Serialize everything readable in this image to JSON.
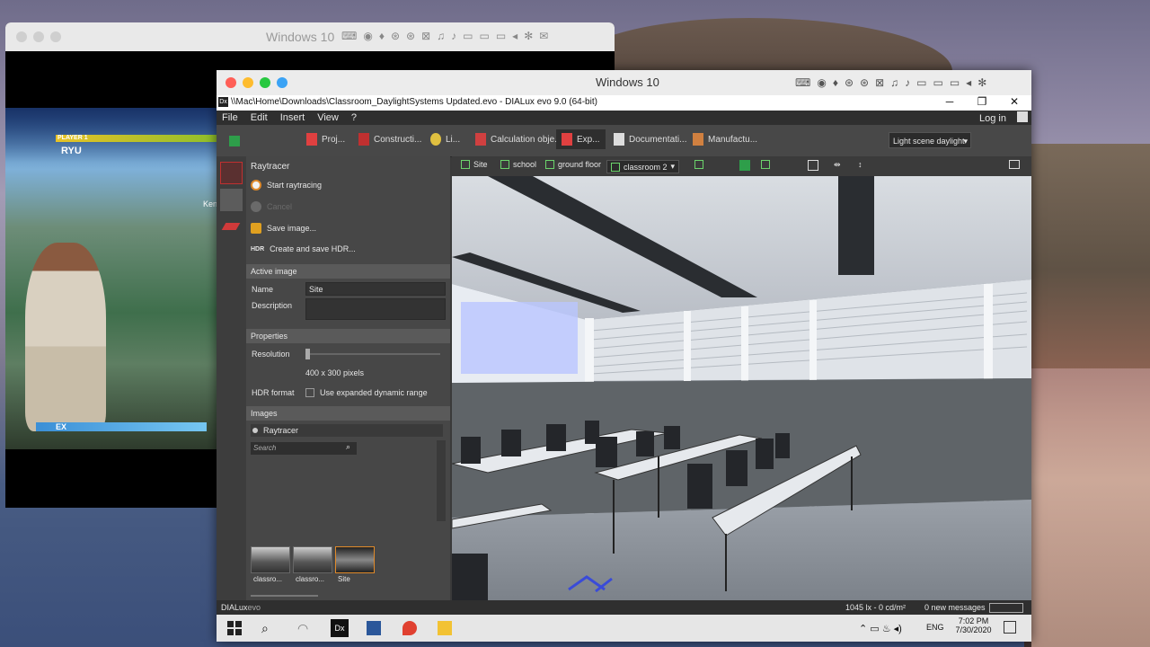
{
  "back_window": {
    "title": "Windows 10",
    "game": {
      "player_label": "PLAYER 1",
      "character": "RYU",
      "opponent": "Ken",
      "ex_label": "EX"
    }
  },
  "main_window": {
    "mac_title": "Windows 10",
    "win_title": "\\\\Mac\\Home\\Downloads\\Classroom_DaylightSystems Updated.evo - DIALux evo 9.0  (64-bit)",
    "app_icon": "Dx",
    "win_controls": {
      "minimize": "─",
      "restore": "❐",
      "close": "✕"
    }
  },
  "menu": {
    "items": [
      "File",
      "Edit",
      "Insert",
      "View",
      "?"
    ],
    "login": "Log in"
  },
  "ribbon": {
    "tabs": [
      {
        "label": "Proj...",
        "color": "#e04040"
      },
      {
        "label": "Constructi...",
        "color": "#e04040"
      },
      {
        "label": "Li...",
        "color": "#e0c040"
      },
      {
        "label": "Calculation obje...",
        "color": "#e04040"
      },
      {
        "label": "Exp...",
        "color": "#e04040"
      },
      {
        "label": "Documentati...",
        "color": "#dddddd"
      },
      {
        "label": "Manufactu...",
        "color": "#d08040"
      }
    ],
    "scene_dropdown": "Light scene daylight"
  },
  "left_panel": {
    "header": "Raytracer",
    "start": "Start raytracing",
    "cancel": "Cancel",
    "save_image": "Save image...",
    "hdr_icon": "HDR",
    "save_hdr": "Create and save HDR...",
    "active_image_header": "Active image",
    "name_label": "Name",
    "name_value": "Site",
    "description_label": "Description",
    "properties_header": "Properties",
    "resolution_label": "Resolution",
    "resolution_value": "400 x 300 pixels",
    "hdr_format_label": "HDR format",
    "hdr_checkbox": "Use expanded dynamic range",
    "images_header": "Images",
    "raytracer_radio": "Raytracer",
    "search_placeholder": "Search",
    "thumbs": [
      "classro...",
      "classro...",
      "Site"
    ]
  },
  "view_toolbar": {
    "breadcrumb": [
      "Site",
      "school",
      "ground floor",
      "classroom 2"
    ]
  },
  "status": {
    "lux": "1045 lx - 0 cd/m²",
    "messages": "0 new messages",
    "brand_a": "DIALux",
    "brand_b": "evo"
  },
  "taskbar": {
    "time": "7:02 PM",
    "date": "7/30/2020",
    "lang": "ENG"
  }
}
